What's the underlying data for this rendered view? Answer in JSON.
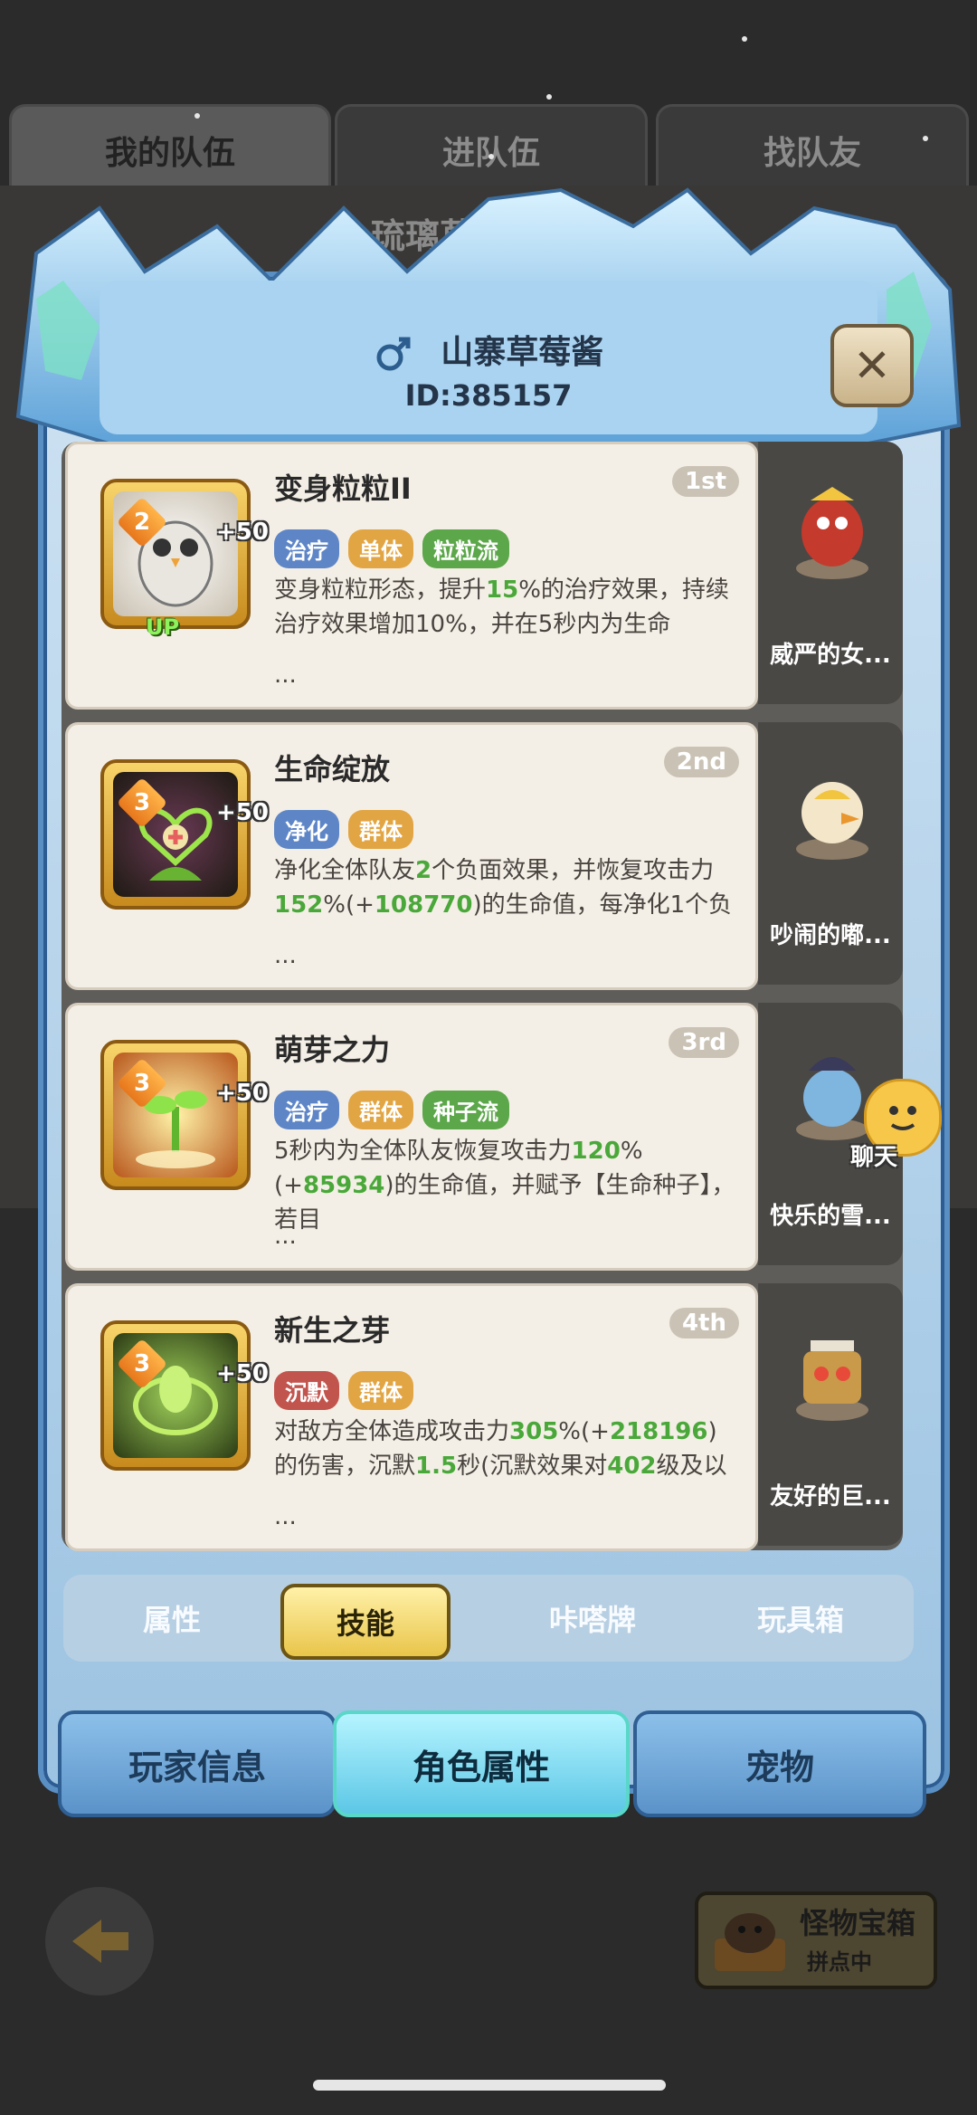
{
  "background": {
    "tabs": [
      "我的队伍",
      "进队伍",
      "找队友"
    ],
    "team_title": "琉璃草莓"
  },
  "player": {
    "name": "山寨草莓酱",
    "id": "ID:385157"
  },
  "skills": [
    {
      "title": "变身粒粒II",
      "rank": "1st",
      "level": "2",
      "bonus": "+50",
      "up": "UP",
      "tags": [
        "治疗",
        "单体",
        "粒粒流"
      ],
      "desc_a": "变身粒粒形态，提升",
      "desc_b": "15",
      "desc_c": "%的治疗效果，持续治疗效果增加10%，并在5秒内为生命",
      "ellipsis": "..."
    },
    {
      "title": "生命绽放",
      "rank": "2nd",
      "level": "3",
      "bonus": "+50",
      "tags": [
        "净化",
        "群体"
      ],
      "desc_a": "净化全体队友",
      "desc_b": "2",
      "desc_c": "个负面效果，并恢复攻击力",
      "desc_d": "152",
      "desc_e": "%(+",
      "desc_f": "108770",
      "desc_g": ")的生命值，每净化1个负",
      "ellipsis": "..."
    },
    {
      "title": "萌芽之力",
      "rank": "3rd",
      "level": "3",
      "bonus": "+50",
      "tags": [
        "治疗",
        "群体",
        "种子流"
      ],
      "desc_a": "5秒内为全体队友恢复攻击力",
      "desc_b": "120",
      "desc_c": "%(+",
      "desc_d": "85934",
      "desc_e": ")的生命值，并赋予【生命种子】，若目",
      "ellipsis": "..."
    },
    {
      "title": "新生之芽",
      "rank": "4th",
      "level": "3",
      "bonus": "+50",
      "tags": [
        "沉默",
        "群体"
      ],
      "desc_a": "对敌方全体造成攻击力",
      "desc_b": "305",
      "desc_c": "%(+",
      "desc_d": "218196",
      "desc_e": ")的伤害，沉默",
      "desc_f": "1.5",
      "desc_g": "秒(沉默效果对",
      "desc_h": "402",
      "desc_i": "级及以",
      "ellipsis": "..."
    }
  ],
  "pets": [
    "威严的女...",
    "吵闹的嘟...",
    "快乐的雪...",
    "友好的巨..."
  ],
  "chat_label": "聊天",
  "sub_tabs": [
    "属性",
    "技能",
    "咔嗒牌",
    "玩具箱"
  ],
  "main_tabs": [
    "玩家信息",
    "角色属性",
    "宠物"
  ],
  "chest": {
    "title": "怪物宝箱",
    "subtitle": "拼点中"
  }
}
